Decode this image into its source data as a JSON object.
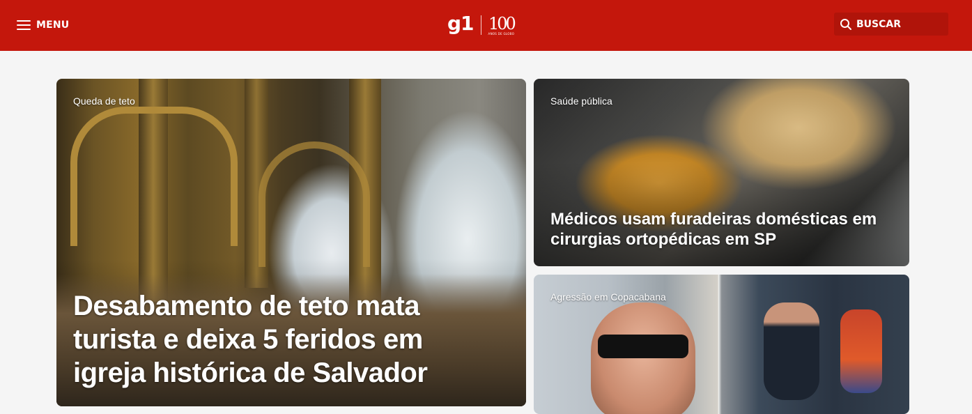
{
  "header": {
    "menu_label": "MENU",
    "logo_text": "g1",
    "logo_badge_number": "100",
    "logo_badge_caption": "ANOS DE GLOBO",
    "search_label": "BUSCAR",
    "brand_color": "#c4170c"
  },
  "cards": {
    "main": {
      "kicker": "Queda de teto",
      "headline": "Desabamento de teto mata turista e deixa 5 feridos em igreja histórica de Salvador"
    },
    "side1": {
      "kicker": "Saúde pública",
      "headline": "Médicos usam furadeiras domésticas em cirurgias ortopédicas em SP"
    },
    "side2": {
      "kicker": "Agressão em Copacabana"
    }
  }
}
